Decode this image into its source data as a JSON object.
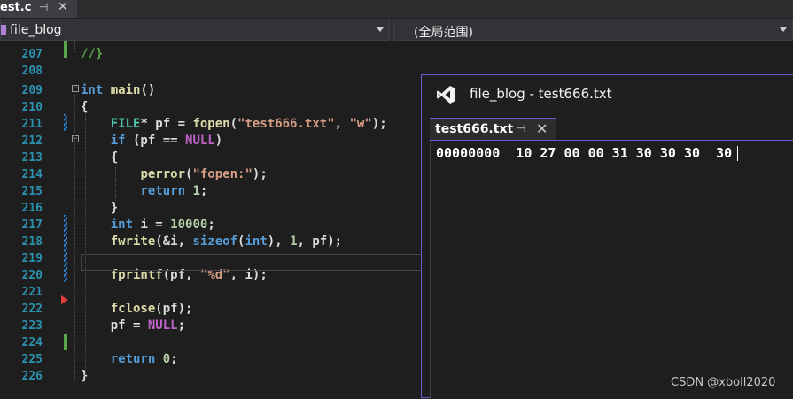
{
  "tab": {
    "title": "est.c",
    "pin": "⊣",
    "close": "✕"
  },
  "nav": {
    "project": "file_blog",
    "scope": "(全局范围)"
  },
  "editor": {
    "lines": [
      {
        "num": "207",
        "code": [
          {
            "c": "c",
            "t": "//}"
          }
        ]
      },
      {
        "num": "208",
        "code": []
      },
      {
        "num": "209",
        "code": [
          {
            "c": "k",
            "t": "int"
          },
          {
            "c": "",
            "t": " "
          },
          {
            "c": "f",
            "t": "main"
          },
          {
            "c": "",
            "t": "()"
          }
        ]
      },
      {
        "num": "210",
        "code": [
          {
            "c": "",
            "t": "{"
          }
        ]
      },
      {
        "num": "211",
        "code": [
          {
            "c": "",
            "t": "    "
          },
          {
            "c": "t",
            "t": "FILE"
          },
          {
            "c": "",
            "t": "* pf = "
          },
          {
            "c": "f",
            "t": "fopen"
          },
          {
            "c": "",
            "t": "("
          },
          {
            "c": "s",
            "t": "\"test666.txt\""
          },
          {
            "c": "",
            "t": ", "
          },
          {
            "c": "s",
            "t": "\"w\""
          },
          {
            "c": "",
            "t": ");"
          }
        ]
      },
      {
        "num": "212",
        "code": [
          {
            "c": "",
            "t": "    "
          },
          {
            "c": "k",
            "t": "if"
          },
          {
            "c": "",
            "t": " (pf == "
          },
          {
            "c": "m",
            "t": "NULL"
          },
          {
            "c": "",
            "t": ")"
          }
        ]
      },
      {
        "num": "213",
        "code": [
          {
            "c": "",
            "t": "    {"
          }
        ]
      },
      {
        "num": "214",
        "code": [
          {
            "c": "",
            "t": "        "
          },
          {
            "c": "f",
            "t": "perror"
          },
          {
            "c": "",
            "t": "("
          },
          {
            "c": "s",
            "t": "\"fopen:\""
          },
          {
            "c": "",
            "t": ");"
          }
        ]
      },
      {
        "num": "215",
        "code": [
          {
            "c": "",
            "t": "        "
          },
          {
            "c": "k",
            "t": "return"
          },
          {
            "c": "",
            "t": " "
          },
          {
            "c": "n",
            "t": "1"
          },
          {
            "c": "",
            "t": ";"
          }
        ]
      },
      {
        "num": "216",
        "code": [
          {
            "c": "",
            "t": "    }"
          }
        ]
      },
      {
        "num": "217",
        "code": [
          {
            "c": "",
            "t": "    "
          },
          {
            "c": "k",
            "t": "int"
          },
          {
            "c": "",
            "t": " i = "
          },
          {
            "c": "n",
            "t": "10000"
          },
          {
            "c": "",
            "t": ";"
          }
        ]
      },
      {
        "num": "218",
        "code": [
          {
            "c": "",
            "t": "    "
          },
          {
            "c": "f",
            "t": "fwrite"
          },
          {
            "c": "",
            "t": "(&i, "
          },
          {
            "c": "k",
            "t": "sizeof"
          },
          {
            "c": "",
            "t": "("
          },
          {
            "c": "k",
            "t": "int"
          },
          {
            "c": "",
            "t": "), "
          },
          {
            "c": "n",
            "t": "1"
          },
          {
            "c": "",
            "t": ", pf);"
          }
        ]
      },
      {
        "num": "219",
        "code": []
      },
      {
        "num": "220",
        "code": [
          {
            "c": "",
            "t": "    "
          },
          {
            "c": "f",
            "t": "fprintf"
          },
          {
            "c": "",
            "t": "(pf, "
          },
          {
            "c": "s",
            "t": "\"%d\""
          },
          {
            "c": "",
            "t": ", i);"
          }
        ]
      },
      {
        "num": "221",
        "code": []
      },
      {
        "num": "222",
        "code": [
          {
            "c": "",
            "t": "    "
          },
          {
            "c": "f",
            "t": "fclose"
          },
          {
            "c": "",
            "t": "(pf);"
          }
        ]
      },
      {
        "num": "223",
        "code": [
          {
            "c": "",
            "t": "    pf = "
          },
          {
            "c": "m",
            "t": "NULL"
          },
          {
            "c": "",
            "t": ";"
          }
        ]
      },
      {
        "num": "224",
        "code": []
      },
      {
        "num": "225",
        "code": [
          {
            "c": "",
            "t": "    "
          },
          {
            "c": "k",
            "t": "return"
          },
          {
            "c": "",
            "t": " "
          },
          {
            "c": "n",
            "t": "0"
          },
          {
            "c": "",
            "t": ";"
          }
        ]
      },
      {
        "num": "226",
        "code": [
          {
            "c": "",
            "t": "}"
          }
        ]
      }
    ]
  },
  "viewer": {
    "title": "file_blog - test666.txt",
    "tab_label": "test666.txt",
    "pin": "⊣",
    "close": "✕",
    "hex_line": "00000000  10 27 00 00 31 30 30 30  30"
  },
  "watermark": "CSDN @xboll2020",
  "colors": {
    "accent": "#6e56cf",
    "line_number": "#2b91af",
    "change_green": "#57a64a",
    "change_blue": "#2b7fd5",
    "breakpoint": "#e03c3c"
  }
}
